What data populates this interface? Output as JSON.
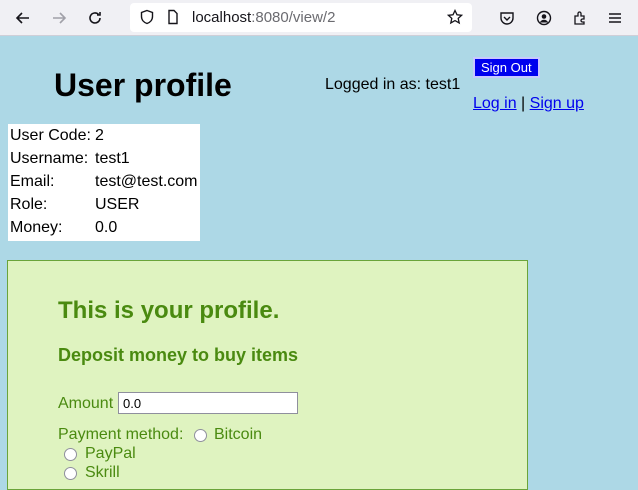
{
  "browser": {
    "url_host": "localhost",
    "url_rest": ":8080/view/2"
  },
  "header": {
    "title": "User profile",
    "logged_in_text": "Logged in as: test1",
    "sign_out_label": "Sign Out",
    "login_label": "Log in",
    "separator": "|",
    "signup_label": "Sign up"
  },
  "user": {
    "rows": [
      {
        "label": "User Code:",
        "value": "2"
      },
      {
        "label": "Username:",
        "value": "test1"
      },
      {
        "label": "Email:",
        "value": "test@test.com"
      },
      {
        "label": "Role:",
        "value": "USER"
      },
      {
        "label": "Money:",
        "value": "0.0"
      }
    ]
  },
  "profile": {
    "heading": "This is your profile.",
    "deposit_heading": "Deposit money to buy items",
    "amount_label": "Amount",
    "amount_value": "0.0",
    "payment_label": "Payment method:",
    "methods": [
      "Bitcoin",
      "PayPal",
      "Skrill"
    ]
  },
  "colors": {
    "page_bg": "#add8e6",
    "panel_bg": "#dff3c0",
    "panel_text": "#4a8a10",
    "signout_bg": "#0000ee"
  }
}
